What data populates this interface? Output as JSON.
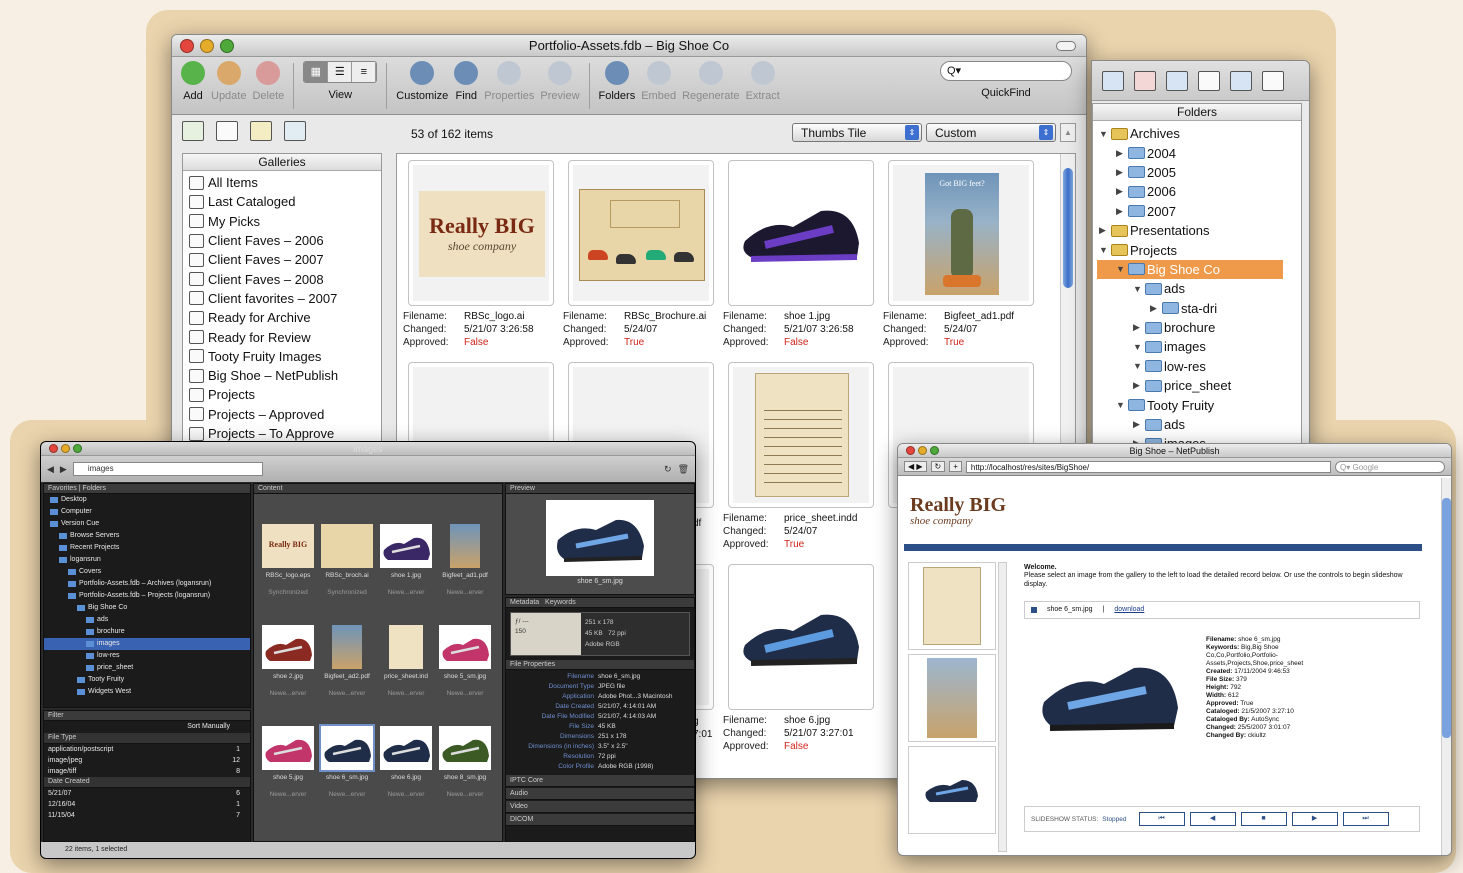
{
  "main_window": {
    "title": "Portfolio-Assets.fdb – Big Shoe Co",
    "toolbar": [
      {
        "label": "Add",
        "icon": "add-icon",
        "enabled": true,
        "color": "#58b34a"
      },
      {
        "label": "Update",
        "icon": "update-icon",
        "enabled": false,
        "color": "#d9a86a"
      },
      {
        "label": "Delete",
        "icon": "delete-icon",
        "enabled": false,
        "color": "#d99a9a"
      }
    ],
    "view_label": "View",
    "toolbar2": [
      {
        "label": "Customize",
        "icon": "customize-icon",
        "enabled": true
      },
      {
        "label": "Find",
        "icon": "find-icon",
        "enabled": true
      },
      {
        "label": "Properties",
        "icon": "properties-icon",
        "enabled": false
      },
      {
        "label": "Preview",
        "icon": "preview-icon",
        "enabled": false
      }
    ],
    "toolbar3": [
      {
        "label": "Folders",
        "icon": "folders-icon",
        "enabled": true
      },
      {
        "label": "Embed",
        "icon": "embed-icon",
        "enabled": false
      },
      {
        "label": "Regenerate",
        "icon": "regenerate-icon",
        "enabled": false
      },
      {
        "label": "Extract",
        "icon": "extract-icon",
        "enabled": false
      }
    ],
    "quickfind_label": "QuickFind",
    "item_count": "53 of 162 items",
    "view_select": "Thumbs Tile",
    "sort_select": "Custom",
    "galleries_header": "Galleries",
    "galleries": [
      "All Items",
      "Last Cataloged",
      "My Picks",
      "Client Faves – 2006",
      "Client Faves – 2007",
      "Client Faves – 2008",
      "Client favorites – 2007",
      "Ready for Archive",
      "Ready for Review",
      "Tooty Fruity Images",
      "Big Shoe – NetPublish",
      "Projects",
      "Projects – Approved",
      "Projects – To Approve"
    ],
    "labels": {
      "filename": "Filename:",
      "changed": "Changed:",
      "approved": "Approved:"
    },
    "tiles": [
      {
        "filename": "RBSc_logo.ai",
        "changed": "5/21/07 3:26:58",
        "approved": "False"
      },
      {
        "filename": "RBSc_Brochure.ai",
        "changed": "5/24/07",
        "approved": "True"
      },
      {
        "filename": "shoe 1.jpg",
        "changed": "5/21/07 3:26:58",
        "approved": "False"
      },
      {
        "filename": "Bigfeet_ad1.pdf",
        "changed": "5/24/07",
        "approved": "True"
      },
      {
        "filename": "price_sheet.indd",
        "changed": "5/24/07",
        "approved": "True"
      },
      {
        "filename": "shoe 6.jpg",
        "changed": "5/21/07 3:27:01",
        "approved": "False"
      }
    ],
    "partial_texts": {
      "df": "df",
      "g": "g",
      "t01": "7:01"
    },
    "logo_text": {
      "big": "Really BIG",
      "small": "shoe company",
      "ad": "Got BIG feet?"
    }
  },
  "folders_window": {
    "header": "Folders",
    "tree": [
      {
        "label": "Archives",
        "depth": 0,
        "open": true,
        "yellow": true
      },
      {
        "label": "2004",
        "depth": 1,
        "open": false
      },
      {
        "label": "2005",
        "depth": 1,
        "open": false
      },
      {
        "label": "2006",
        "depth": 1,
        "open": false
      },
      {
        "label": "2007",
        "depth": 1,
        "open": false
      },
      {
        "label": "Presentations",
        "depth": 0,
        "open": false,
        "yellow": true
      },
      {
        "label": "Projects",
        "depth": 0,
        "open": true,
        "yellow": true
      },
      {
        "label": "Big Shoe Co",
        "depth": 1,
        "open": true,
        "selected": true
      },
      {
        "label": "ads",
        "depth": 2,
        "open": true
      },
      {
        "label": "sta-dri",
        "depth": 3,
        "open": false
      },
      {
        "label": "brochure",
        "depth": 2,
        "open": false
      },
      {
        "label": "images",
        "depth": 2,
        "open": true
      },
      {
        "label": "low-res",
        "depth": 2,
        "open": true
      },
      {
        "label": "price_sheet",
        "depth": 2,
        "open": false
      },
      {
        "label": "Tooty Fruity",
        "depth": 1,
        "open": true
      },
      {
        "label": "ads",
        "depth": 2,
        "open": false
      },
      {
        "label": "images",
        "depth": 2,
        "open": false
      }
    ]
  },
  "dark_window": {
    "title": "images",
    "path": "images",
    "tabs": {
      "favorites": "Favorites",
      "folders": "Folders",
      "content": "Content",
      "preview": "Preview",
      "metadata": "Metadata",
      "keywords": "Keywords",
      "filter": "Filter"
    },
    "nav": [
      {
        "label": "Desktop",
        "depth": 0
      },
      {
        "label": "Computer",
        "depth": 0
      },
      {
        "label": "Version Cue",
        "depth": 0
      },
      {
        "label": "Browse Servers",
        "depth": 1
      },
      {
        "label": "Recent Projects",
        "depth": 1
      },
      {
        "label": "logansrun",
        "depth": 1
      },
      {
        "label": "Covers",
        "depth": 2
      },
      {
        "label": "Portfolio-Assets.fdb – Archives (logansrun)",
        "depth": 2
      },
      {
        "label": "Portfolio-Assets.fdb – Projects (logansrun)",
        "depth": 2
      },
      {
        "label": "Big Shoe Co",
        "depth": 3
      },
      {
        "label": "ads",
        "depth": 4
      },
      {
        "label": "brochure",
        "depth": 4
      },
      {
        "label": "images",
        "depth": 4,
        "selected": true
      },
      {
        "label": "low-res",
        "depth": 4
      },
      {
        "label": "price_sheet",
        "depth": 4
      },
      {
        "label": "Tooty Fruity",
        "depth": 3
      },
      {
        "label": "Widgets West",
        "depth": 3
      }
    ],
    "sort": "Sort Manually",
    "filter_groups": [
      {
        "title": "File Type",
        "items": [
          {
            "label": "application/postscript",
            "count": "1"
          },
          {
            "label": "image/jpeg",
            "count": "12"
          },
          {
            "label": "image/tiff",
            "count": "8"
          }
        ]
      },
      {
        "title": "Date Created",
        "items": [
          {
            "label": "5/21/07",
            "count": "6"
          },
          {
            "label": "12/16/04",
            "count": "1"
          },
          {
            "label": "11/15/04",
            "count": "7"
          }
        ]
      }
    ],
    "content_rows": [
      [
        {
          "name": "RBSc_logo.eps",
          "sub": "Synchronized"
        },
        {
          "name": "RBSc_broch.ai",
          "sub": "Synchronized"
        },
        {
          "name": "shoe 1.jpg",
          "sub": "Newe...erver"
        },
        {
          "name": "Bigfeet_ad1.pdf",
          "sub": "Newe...erver"
        }
      ],
      [
        {
          "name": "shoe 2.jpg",
          "sub": "Newe...erver"
        },
        {
          "name": "Bigfeet_ad2.pdf",
          "sub": "Newe...erver"
        },
        {
          "name": "price_sheet.ind",
          "sub": "Newe...erver"
        },
        {
          "name": "shoe 5_sm.jpg",
          "sub": "Newe...erver"
        }
      ],
      [
        {
          "name": "shoe 5.jpg",
          "sub": "Newe...erver"
        },
        {
          "name": "shoe 6_sm.jpg",
          "sub": "Newe...erver"
        },
        {
          "name": "shoe 6.jpg",
          "sub": "Newe...erver"
        },
        {
          "name": "shoe 8_sm.jpg",
          "sub": "Newe...erver"
        }
      ]
    ],
    "preview_caption": "shoe 6_sm.jpg",
    "camera": {
      "dims": "251 x 178",
      "size": "45 KB",
      "ppi": "72 ppi",
      "space": "Adobe RGB",
      "iso": "150"
    },
    "file_props_header": "File Properties",
    "file_props": [
      {
        "k": "Filename",
        "v": "shoe 6_sm.jpg"
      },
      {
        "k": "Document Type",
        "v": "JPEG file"
      },
      {
        "k": "Application",
        "v": "Adobe Phot...3 Macintosh"
      },
      {
        "k": "Date Created",
        "v": "5/21/07, 4:14:01 AM"
      },
      {
        "k": "Date File Modified",
        "v": "5/21/07, 4:14:03 AM"
      },
      {
        "k": "File Size",
        "v": "45 KB"
      },
      {
        "k": "Dimensions",
        "v": "251 x 178"
      },
      {
        "k": "Dimensions (in inches)",
        "v": "3.5\" x 2.5\""
      },
      {
        "k": "Resolution",
        "v": "72 ppi"
      },
      {
        "k": "Color Profile",
        "v": "Adobe RGB (1998)"
      }
    ],
    "sections": [
      "IPTC Core",
      "Audio",
      "Video",
      "DICOM"
    ],
    "status": "22 items, 1 selected"
  },
  "browser_window": {
    "title": "Big Shoe – NetPublish",
    "url": "http://localhost/res/sites/BigShoe/",
    "search_placeholder": "Google",
    "logo_big": "Really BIG",
    "logo_small": "shoe company",
    "welcome": "Welcome.",
    "intro": "Please select an image from the gallery to the left to load the detailed record below. Or use the controls to begin slideshow display.",
    "file": "shoe 6_sm.jpg",
    "download": "download",
    "record": [
      {
        "k": "Filename:",
        "v": "shoe 6_sm.jpg"
      },
      {
        "k": "Keywords:",
        "v": "Big,Big Shoe Co,Co,Portfolio,Portfolio-Assets,Projects,Shoe,price_sheet"
      },
      {
        "k": "Created:",
        "v": "17/11/2004 9:46:53"
      },
      {
        "k": "File Size:",
        "v": "379"
      },
      {
        "k": "Height:",
        "v": "792"
      },
      {
        "k": "Width:",
        "v": "612"
      },
      {
        "k": "Approved:",
        "v": "True"
      },
      {
        "k": "Cataloged:",
        "v": "21/5/2007 3:27:10"
      },
      {
        "k": "Cataloged By:",
        "v": "AutoSync"
      },
      {
        "k": "Changed:",
        "v": "25/5/2007 3:01:07"
      },
      {
        "k": "Changed By:",
        "v": "ckiultz"
      }
    ],
    "slideshow_label": "SLIDESHOW STATUS:",
    "slideshow_status": "Stopped",
    "controls": [
      "⏮",
      "◀",
      "■",
      "▶",
      "⏭"
    ]
  },
  "colors": {
    "accent_orange": "#ef9a4a",
    "false_red": "#d0231a",
    "shoe_purple": "#5a2c9a",
    "shoe_blue": "#2c4f86",
    "netpublish_bar": "#2d4f87"
  }
}
